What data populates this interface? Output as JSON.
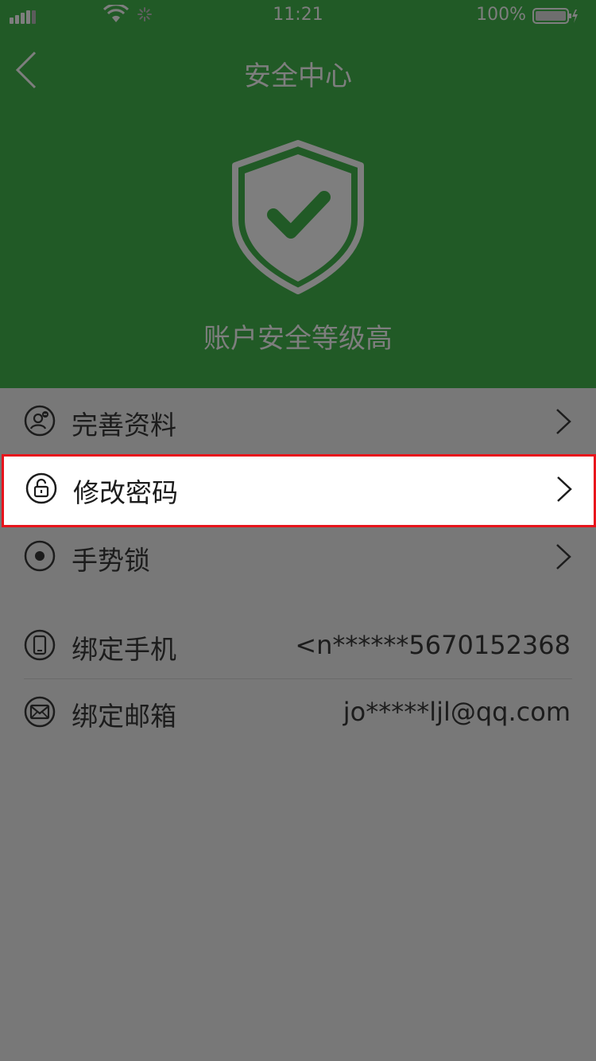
{
  "status_bar": {
    "time": "11:21",
    "battery": "100%"
  },
  "nav": {
    "title": "安全中心"
  },
  "header": {
    "level_text": "账户安全等级高"
  },
  "menu": {
    "complete_profile": "完善资料",
    "change_password": "修改密码",
    "gesture_lock": "手势锁"
  },
  "bindings": {
    "phone_label": "绑定手机",
    "phone_value": "<n******5670152368",
    "email_label": "绑定邮箱",
    "email_value": "jo*****ljl@qq.com"
  },
  "colors": {
    "header_bg": "#215a26",
    "overlay_gray": "#787878",
    "highlight_border": "#e8141c"
  }
}
